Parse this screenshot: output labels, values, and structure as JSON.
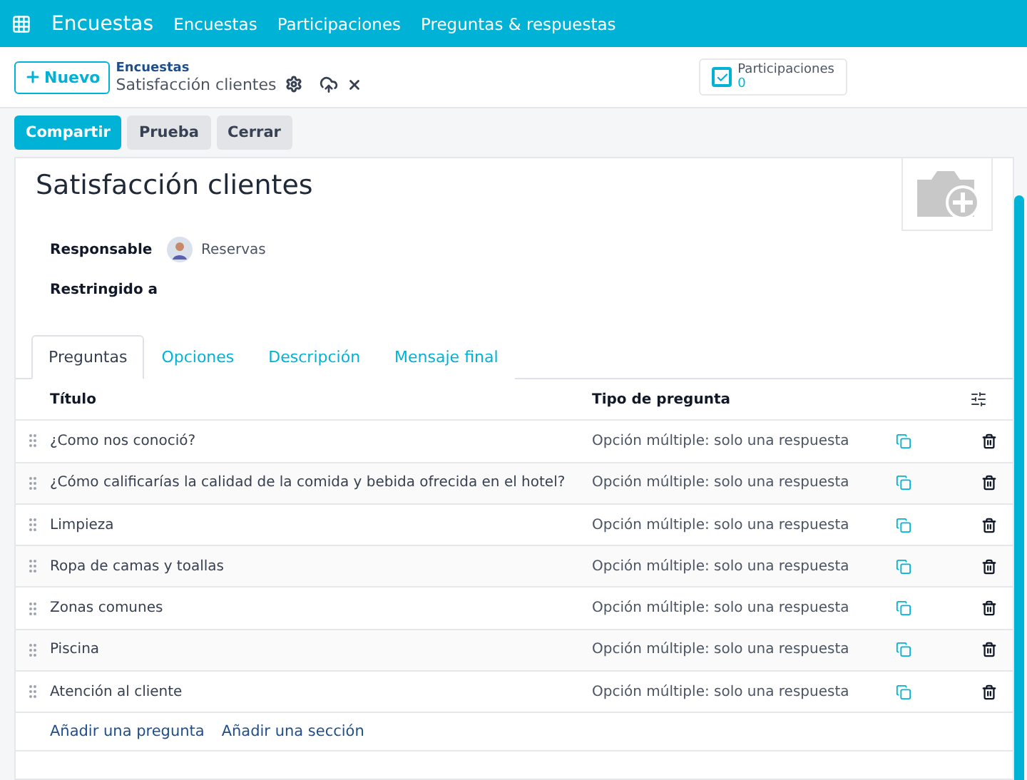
{
  "navbar": {
    "app": "Encuestas",
    "menu": [
      "Encuestas",
      "Participaciones",
      "Preguntas & respuestas"
    ]
  },
  "control": {
    "new_button": "Nuevo",
    "breadcrumb": "Encuestas",
    "record": "Satisfacción clientes",
    "stat": {
      "label": "Participaciones",
      "value": "0"
    }
  },
  "actions": [
    {
      "label": "Compartir",
      "kind": "primary"
    },
    {
      "label": "Prueba",
      "kind": "secondary"
    },
    {
      "label": "Cerrar",
      "kind": "secondary"
    }
  ],
  "form": {
    "title": "Satisfacción clientes",
    "fields": [
      {
        "label": "Responsable",
        "value": "Reservas"
      },
      {
        "label": "Restringido a"
      }
    ]
  },
  "tabs": [
    {
      "label": "Preguntas",
      "selected": true
    },
    {
      "label": "Opciones",
      "selected": false
    },
    {
      "label": "Descripción",
      "selected": false
    },
    {
      "label": "Mensaje final",
      "selected": false
    }
  ],
  "table": {
    "columns": [
      "Título",
      "Tipo de pregunta"
    ],
    "rows": [
      {
        "title": "¿Como nos conoció?",
        "type": "Opción múltiple: solo una respuesta"
      },
      {
        "title": "¿Cómo calificarías la calidad de la comida y bebida ofrecida en el hotel?",
        "type": "Opción múltiple: solo una respuesta"
      },
      {
        "title": "Limpieza",
        "type": "Opción múltiple: solo una respuesta"
      },
      {
        "title": "Ropa de camas y toallas",
        "type": "Opción múltiple: solo una respuesta"
      },
      {
        "title": "Zonas comunes",
        "type": "Opción múltiple: solo una respuesta"
      },
      {
        "title": "Piscina",
        "type": "Opción múltiple: solo una respuesta"
      },
      {
        "title": "Atención al cliente",
        "type": "Opción múltiple: solo una respuesta"
      }
    ],
    "links": [
      "Añadir una pregunta",
      "Añadir una sección"
    ]
  }
}
